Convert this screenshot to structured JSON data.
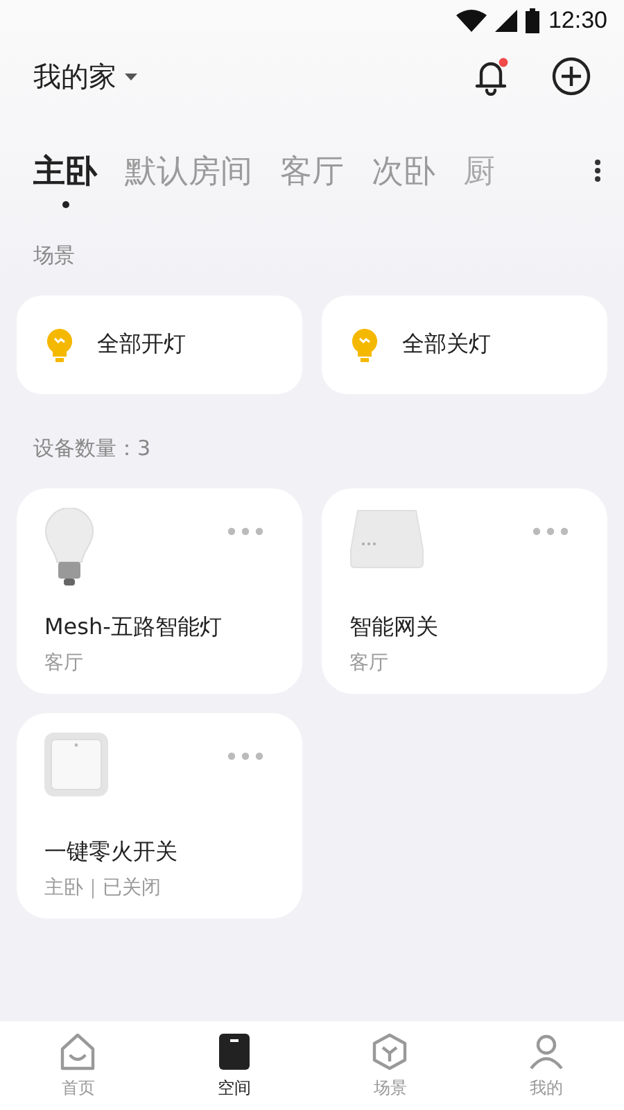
{
  "status_bar": {
    "time": "12:30"
  },
  "header": {
    "home_name": "我的家",
    "notification_unread": true
  },
  "room_tabs": [
    {
      "label": "主卧",
      "selected": true
    },
    {
      "label": "默认房间",
      "selected": false
    },
    {
      "label": "客厅",
      "selected": false
    },
    {
      "label": "次卧",
      "selected": false
    },
    {
      "label": "厨",
      "selected": false
    }
  ],
  "scenes": {
    "title": "场景",
    "items": [
      {
        "label": "全部开灯"
      },
      {
        "label": "全部关灯"
      }
    ]
  },
  "devices": {
    "count_label": "设备数量：3",
    "items": [
      {
        "kind": "bulb",
        "name": "Mesh-五路智能灯",
        "info": "客厅"
      },
      {
        "kind": "gateway",
        "name": "智能网关",
        "info": "客厅"
      },
      {
        "kind": "switch",
        "name": "一键零火开关",
        "info": "主卧｜已关闭"
      }
    ]
  },
  "bottom_nav": [
    {
      "kind": "home",
      "label": "首页",
      "selected": false
    },
    {
      "kind": "space",
      "label": "空间",
      "selected": true
    },
    {
      "kind": "scene",
      "label": "场景",
      "selected": false
    },
    {
      "kind": "me",
      "label": "我的",
      "selected": false
    }
  ]
}
